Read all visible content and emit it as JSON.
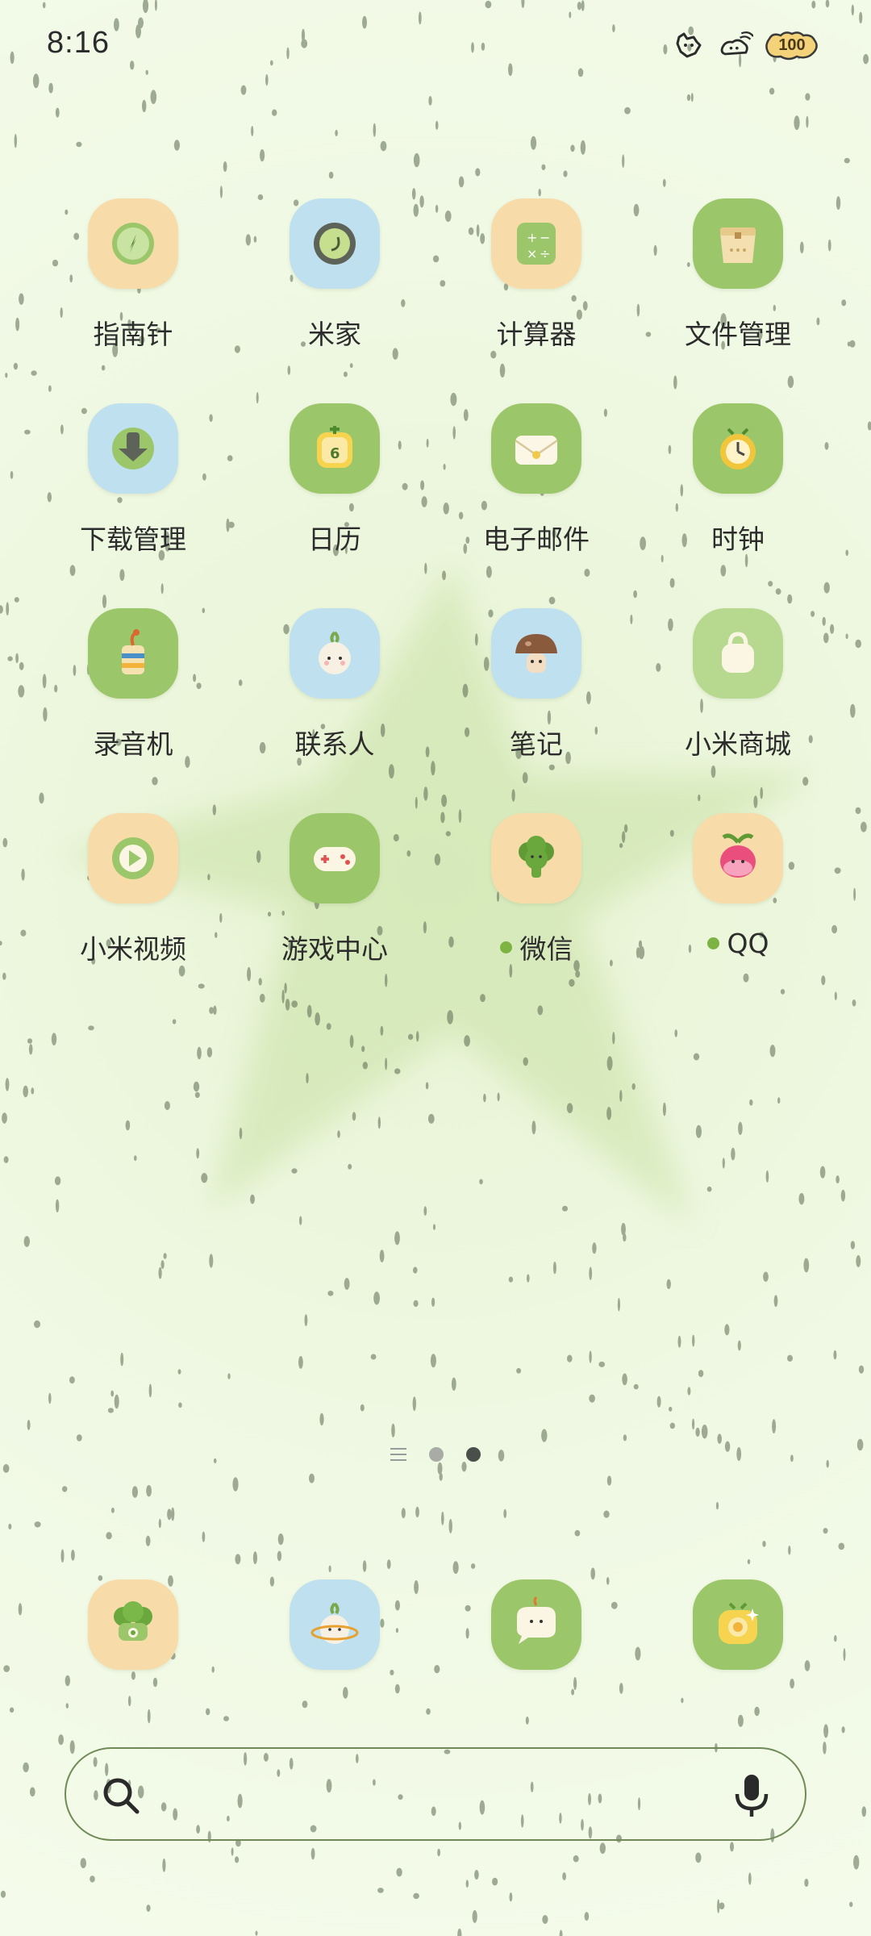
{
  "status_bar": {
    "time": "8:16",
    "battery_level": "100",
    "icons": [
      "notification-cat-icon",
      "wifi-icon",
      "battery-icon"
    ]
  },
  "apps": [
    {
      "label": "指南针",
      "icon": "compass-icon",
      "bg": "#f7dcaa",
      "dot": false
    },
    {
      "label": "米家",
      "icon": "mi-home-icon",
      "bg": "#bfe0ef",
      "dot": false
    },
    {
      "label": "计算器",
      "icon": "calculator-icon",
      "bg": "#f7dcaa",
      "dot": false
    },
    {
      "label": "文件管理",
      "icon": "folder-bag-icon",
      "bg": "#9bc76a",
      "dot": false
    },
    {
      "label": "下载管理",
      "icon": "download-arrow-icon",
      "bg": "#bfe0ef",
      "dot": false
    },
    {
      "label": "日历",
      "icon": "calendar-icon",
      "bg": "#9bc76a",
      "dot": false
    },
    {
      "label": "电子邮件",
      "icon": "mail-envelope-icon",
      "bg": "#9bc76a",
      "dot": false
    },
    {
      "label": "时钟",
      "icon": "clock-icon",
      "bg": "#9bc76a",
      "dot": false
    },
    {
      "label": "录音机",
      "icon": "recorder-cup-icon",
      "bg": "#9bc76a",
      "dot": false
    },
    {
      "label": "联系人",
      "icon": "contacts-onion-icon",
      "bg": "#bfe0ef",
      "dot": false
    },
    {
      "label": "笔记",
      "icon": "notes-mushroom-icon",
      "bg": "#bfe0ef",
      "dot": false
    },
    {
      "label": "小米商城",
      "icon": "shopping-bag-icon",
      "bg": "#b7d98f",
      "dot": false
    },
    {
      "label": "小米视频",
      "icon": "video-play-icon",
      "bg": "#f7dcaa",
      "dot": false
    },
    {
      "label": "游戏中心",
      "icon": "gamepad-icon",
      "bg": "#9bc76a",
      "dot": false
    },
    {
      "label": "微信",
      "icon": "wechat-broccoli-icon",
      "bg": "#f7dcaa",
      "dot": true
    },
    {
      "label": "QQ",
      "icon": "qq-radish-icon",
      "bg": "#f7dcaa",
      "dot": true
    }
  ],
  "page_indicator": {
    "pages": 2,
    "active_index": 1
  },
  "dock": [
    {
      "icon": "phone-broccoli-icon",
      "bg": "#f7dcaa"
    },
    {
      "icon": "browser-onion-planet-icon",
      "bg": "#bfe0ef"
    },
    {
      "icon": "messages-bubble-icon",
      "bg": "#9bc76a"
    },
    {
      "icon": "camera-icon",
      "bg": "#9bc76a"
    }
  ],
  "search": {
    "placeholder": ""
  }
}
